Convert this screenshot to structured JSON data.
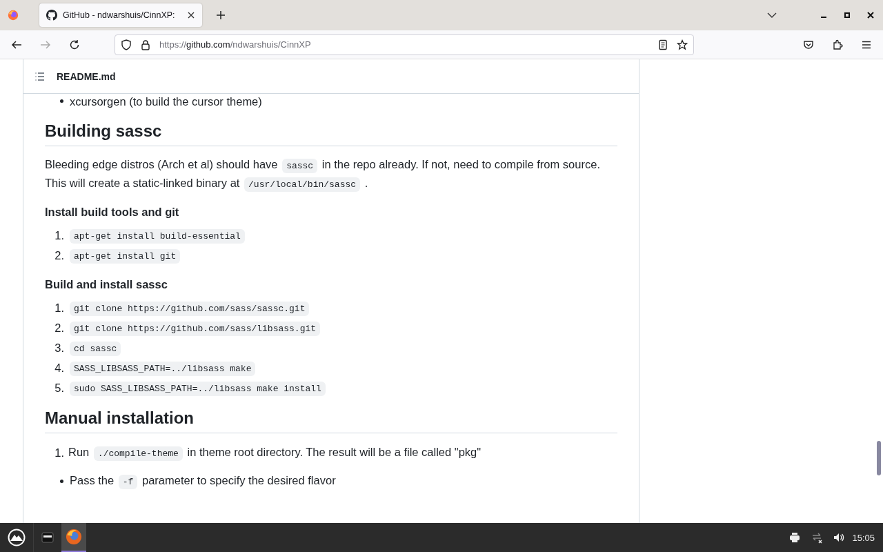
{
  "browser": {
    "tabs": [
      {
        "title": "GitHub - ndwarshuis/CinnXP:",
        "selected": true
      }
    ],
    "url": {
      "scheme": "https://",
      "host": "github.com",
      "path": "/ndwarshuis/CinnXP"
    },
    "forward_disabled": true
  },
  "readme": {
    "filename": "README.md",
    "blocks": [
      {
        "kind": "bullets",
        "items": [
          {
            "parts": [
              {
                "kind": "text",
                "text": "xcursorgen (to build the cursor theme)"
              }
            ]
          }
        ]
      },
      {
        "kind": "h2",
        "text": "Building sassc"
      },
      {
        "kind": "para",
        "parts": [
          {
            "kind": "text",
            "text": "Bleeding edge distros (Arch et al) should have "
          },
          {
            "kind": "code",
            "text": "sassc"
          },
          {
            "kind": "text",
            "text": " in the repo already. If not, need to compile from source. This will create a static-linked binary at "
          },
          {
            "kind": "code",
            "text": "/usr/local/bin/sassc"
          },
          {
            "kind": "text",
            "text": " ."
          }
        ]
      },
      {
        "kind": "h4",
        "text": "Install build tools and git"
      },
      {
        "kind": "numbered",
        "items": [
          {
            "number": "1.",
            "parts": [
              {
                "kind": "code",
                "text": "apt-get install build-essential"
              }
            ]
          },
          {
            "number": "2.",
            "parts": [
              {
                "kind": "code",
                "text": "apt-get install git"
              }
            ]
          }
        ]
      },
      {
        "kind": "h4",
        "text": "Build and install sassc"
      },
      {
        "kind": "numbered",
        "items": [
          {
            "number": "1.",
            "parts": [
              {
                "kind": "code",
                "text": "git clone https://github.com/sass/sassc.git"
              }
            ]
          },
          {
            "number": "2.",
            "parts": [
              {
                "kind": "code",
                "text": "git clone https://github.com/sass/libsass.git"
              }
            ]
          },
          {
            "number": "3.",
            "parts": [
              {
                "kind": "code",
                "text": "cd sassc"
              }
            ]
          },
          {
            "number": "4.",
            "parts": [
              {
                "kind": "code",
                "text": "SASS_LIBSASS_PATH=../libsass make"
              }
            ]
          },
          {
            "number": "5.",
            "parts": [
              {
                "kind": "code",
                "text": "sudo SASS_LIBSASS_PATH=../libsass make install"
              }
            ]
          }
        ]
      },
      {
        "kind": "h2",
        "text": "Manual installation"
      },
      {
        "kind": "numbered",
        "items": [
          {
            "number": "1.",
            "parts": [
              {
                "kind": "text",
                "text": "Run "
              },
              {
                "kind": "code",
                "text": "./compile-theme"
              },
              {
                "kind": "text",
                "text": " in theme root directory. The result will be a file called \"pkg\""
              }
            ],
            "children": [
              {
                "parts": [
                  {
                    "kind": "text",
                    "text": "Pass the "
                  },
                  {
                    "kind": "code",
                    "text": "-f"
                  },
                  {
                    "kind": "text",
                    "text": " parameter to specify the desired flavor"
                  }
                ]
              }
            ]
          }
        ]
      }
    ]
  },
  "taskbar": {
    "clock": "15:05"
  }
}
